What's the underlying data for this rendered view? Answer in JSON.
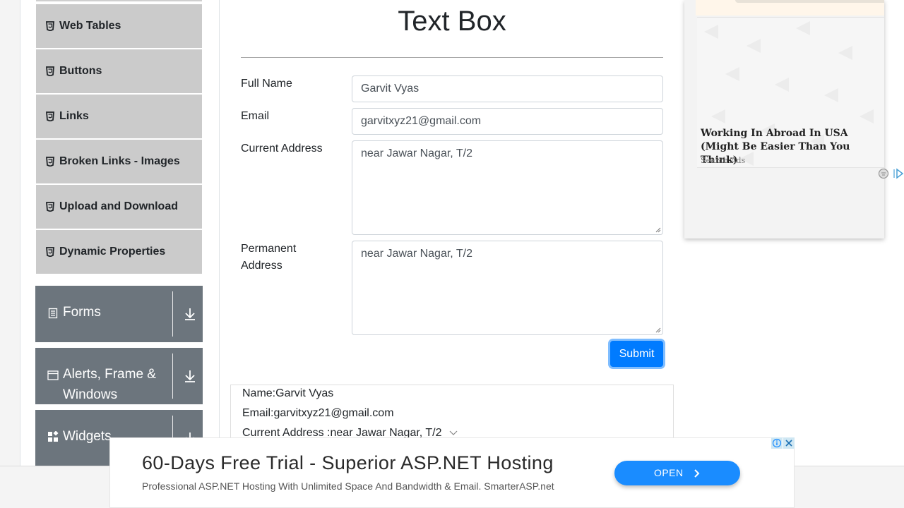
{
  "sidebar": {
    "items": [
      {
        "label": "Web Tables"
      },
      {
        "label": "Buttons"
      },
      {
        "label": "Links"
      },
      {
        "label": "Broken Links - Images"
      },
      {
        "label": "Upload and Download"
      },
      {
        "label": "Dynamic Properties"
      }
    ],
    "groups": [
      {
        "label": "Forms",
        "icon": "form-icon"
      },
      {
        "label": "Alerts, Frame & Windows",
        "icon": "window-icon"
      },
      {
        "label": "Widgets",
        "icon": "widgets-icon"
      }
    ]
  },
  "main": {
    "title": "Text Box",
    "fields": {
      "full_name": {
        "label": "Full Name",
        "value": "Garvit Vyas"
      },
      "email": {
        "label": "Email",
        "value": "garvitxyz21@gmail.com"
      },
      "current_address": {
        "label": "Current Address",
        "value": "near Jawar Nagar, T/2"
      },
      "permanent_address": {
        "label": "Permanent Address",
        "value": "near Jawar Nagar, T/2"
      }
    },
    "submit_label": "Submit",
    "output": {
      "name": "Name:Garvit Vyas",
      "email": "Email:garvitxyz21@gmail.com",
      "current_address": "Current Address :near Jawar Nagar, T/2"
    }
  },
  "side_ad": {
    "headline": "Working In Abroad In USA (Might Be Easier Than You Think)",
    "source": "Search Ads"
  },
  "bottom_ad": {
    "title": "60-Days Free Trial - Superior ASP.NET Hosting",
    "subtitle": "Professional ASP.NET Hosting With Unlimited Space And Bandwidth & Email. SmarterASP.net",
    "cta": "OPEN"
  },
  "colors": {
    "primary": "#007bff",
    "menu_item_bg": "#cbcbcb",
    "group_bg": "#6c757d",
    "ad_cta": "#1a8cff"
  }
}
